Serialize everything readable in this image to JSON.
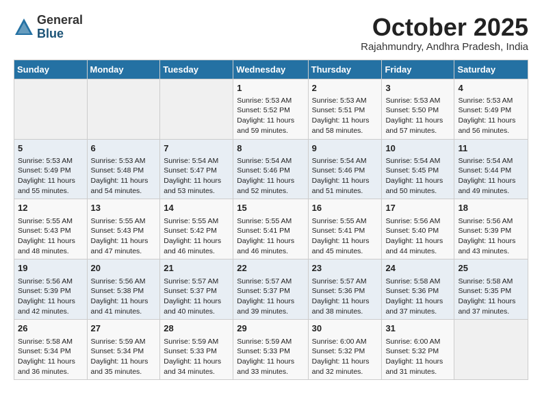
{
  "logo": {
    "general": "General",
    "blue": "Blue"
  },
  "title": "October 2025",
  "location": "Rajahmundry, Andhra Pradesh, India",
  "headers": [
    "Sunday",
    "Monday",
    "Tuesday",
    "Wednesday",
    "Thursday",
    "Friday",
    "Saturday"
  ],
  "weeks": [
    [
      {
        "day": "",
        "info": ""
      },
      {
        "day": "",
        "info": ""
      },
      {
        "day": "",
        "info": ""
      },
      {
        "day": "1",
        "info": "Sunrise: 5:53 AM\nSunset: 5:52 PM\nDaylight: 11 hours and 59 minutes."
      },
      {
        "day": "2",
        "info": "Sunrise: 5:53 AM\nSunset: 5:51 PM\nDaylight: 11 hours and 58 minutes."
      },
      {
        "day": "3",
        "info": "Sunrise: 5:53 AM\nSunset: 5:50 PM\nDaylight: 11 hours and 57 minutes."
      },
      {
        "day": "4",
        "info": "Sunrise: 5:53 AM\nSunset: 5:49 PM\nDaylight: 11 hours and 56 minutes."
      }
    ],
    [
      {
        "day": "5",
        "info": "Sunrise: 5:53 AM\nSunset: 5:49 PM\nDaylight: 11 hours and 55 minutes."
      },
      {
        "day": "6",
        "info": "Sunrise: 5:53 AM\nSunset: 5:48 PM\nDaylight: 11 hours and 54 minutes."
      },
      {
        "day": "7",
        "info": "Sunrise: 5:54 AM\nSunset: 5:47 PM\nDaylight: 11 hours and 53 minutes."
      },
      {
        "day": "8",
        "info": "Sunrise: 5:54 AM\nSunset: 5:46 PM\nDaylight: 11 hours and 52 minutes."
      },
      {
        "day": "9",
        "info": "Sunrise: 5:54 AM\nSunset: 5:46 PM\nDaylight: 11 hours and 51 minutes."
      },
      {
        "day": "10",
        "info": "Sunrise: 5:54 AM\nSunset: 5:45 PM\nDaylight: 11 hours and 50 minutes."
      },
      {
        "day": "11",
        "info": "Sunrise: 5:54 AM\nSunset: 5:44 PM\nDaylight: 11 hours and 49 minutes."
      }
    ],
    [
      {
        "day": "12",
        "info": "Sunrise: 5:55 AM\nSunset: 5:43 PM\nDaylight: 11 hours and 48 minutes."
      },
      {
        "day": "13",
        "info": "Sunrise: 5:55 AM\nSunset: 5:43 PM\nDaylight: 11 hours and 47 minutes."
      },
      {
        "day": "14",
        "info": "Sunrise: 5:55 AM\nSunset: 5:42 PM\nDaylight: 11 hours and 46 minutes."
      },
      {
        "day": "15",
        "info": "Sunrise: 5:55 AM\nSunset: 5:41 PM\nDaylight: 11 hours and 46 minutes."
      },
      {
        "day": "16",
        "info": "Sunrise: 5:55 AM\nSunset: 5:41 PM\nDaylight: 11 hours and 45 minutes."
      },
      {
        "day": "17",
        "info": "Sunrise: 5:56 AM\nSunset: 5:40 PM\nDaylight: 11 hours and 44 minutes."
      },
      {
        "day": "18",
        "info": "Sunrise: 5:56 AM\nSunset: 5:39 PM\nDaylight: 11 hours and 43 minutes."
      }
    ],
    [
      {
        "day": "19",
        "info": "Sunrise: 5:56 AM\nSunset: 5:39 PM\nDaylight: 11 hours and 42 minutes."
      },
      {
        "day": "20",
        "info": "Sunrise: 5:56 AM\nSunset: 5:38 PM\nDaylight: 11 hours and 41 minutes."
      },
      {
        "day": "21",
        "info": "Sunrise: 5:57 AM\nSunset: 5:37 PM\nDaylight: 11 hours and 40 minutes."
      },
      {
        "day": "22",
        "info": "Sunrise: 5:57 AM\nSunset: 5:37 PM\nDaylight: 11 hours and 39 minutes."
      },
      {
        "day": "23",
        "info": "Sunrise: 5:57 AM\nSunset: 5:36 PM\nDaylight: 11 hours and 38 minutes."
      },
      {
        "day": "24",
        "info": "Sunrise: 5:58 AM\nSunset: 5:36 PM\nDaylight: 11 hours and 37 minutes."
      },
      {
        "day": "25",
        "info": "Sunrise: 5:58 AM\nSunset: 5:35 PM\nDaylight: 11 hours and 37 minutes."
      }
    ],
    [
      {
        "day": "26",
        "info": "Sunrise: 5:58 AM\nSunset: 5:34 PM\nDaylight: 11 hours and 36 minutes."
      },
      {
        "day": "27",
        "info": "Sunrise: 5:59 AM\nSunset: 5:34 PM\nDaylight: 11 hours and 35 minutes."
      },
      {
        "day": "28",
        "info": "Sunrise: 5:59 AM\nSunset: 5:33 PM\nDaylight: 11 hours and 34 minutes."
      },
      {
        "day": "29",
        "info": "Sunrise: 5:59 AM\nSunset: 5:33 PM\nDaylight: 11 hours and 33 minutes."
      },
      {
        "day": "30",
        "info": "Sunrise: 6:00 AM\nSunset: 5:32 PM\nDaylight: 11 hours and 32 minutes."
      },
      {
        "day": "31",
        "info": "Sunrise: 6:00 AM\nSunset: 5:32 PM\nDaylight: 11 hours and 31 minutes."
      },
      {
        "day": "",
        "info": ""
      }
    ]
  ]
}
